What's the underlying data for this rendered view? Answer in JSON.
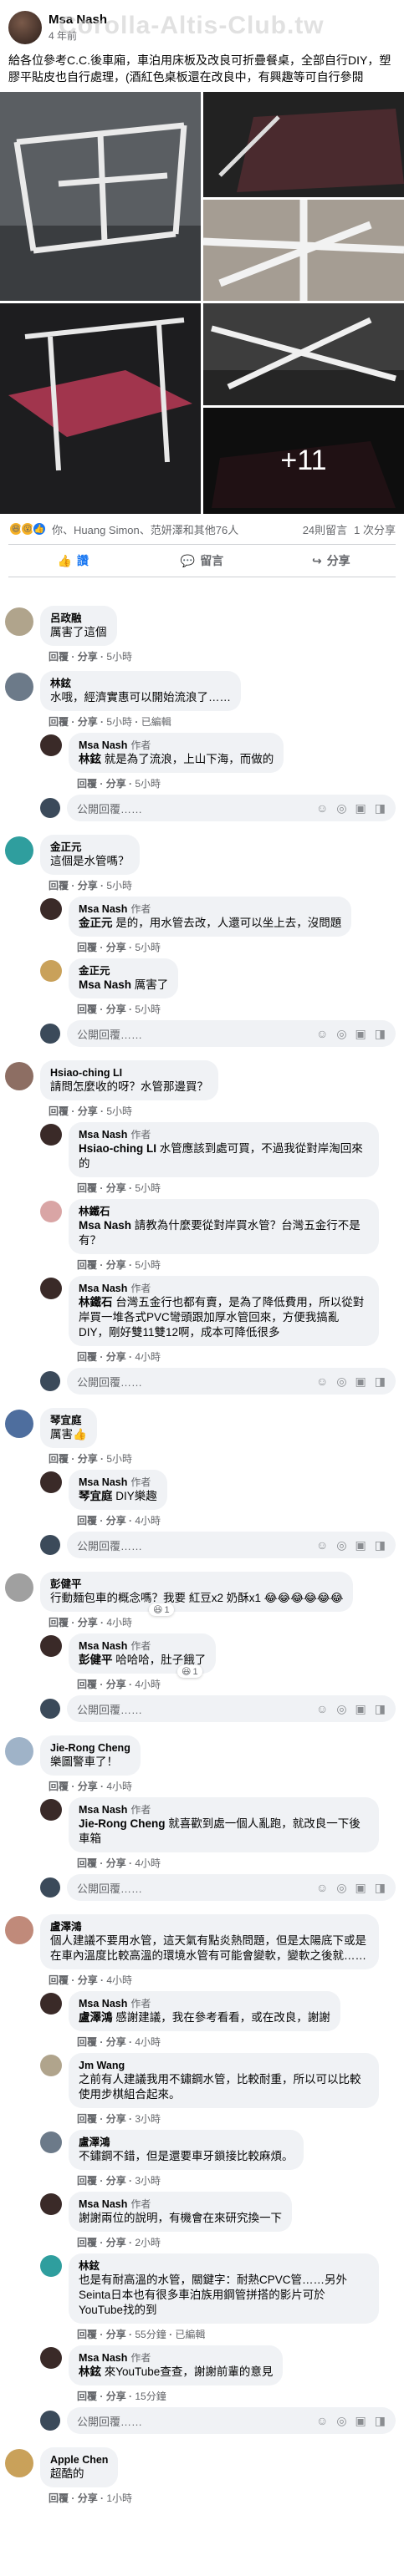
{
  "post": {
    "author": "Msa Nash",
    "time": "4 年前",
    "watermark": "Corolla-Altis-Club.tw",
    "text": "給各位參考C.C.後車廂，車泊用床板及改良可折疊餐桌，全部自行DIY，塑膠平貼皮也自行處理，(酒紅色桌板還在改良中，有興趣等可自行參閱",
    "more_photos": "+11",
    "reactions_text": "你、Huang Simon、范妍澤和其他76人",
    "comment_count": "24則留言",
    "share_count": "1 次分享",
    "actions": {
      "like": "讚",
      "comment": "留言",
      "share": "分享"
    }
  },
  "comments": [
    {
      "name": "呂政融",
      "text": "厲害了這個",
      "reply": "回覆",
      "share": "分享",
      "time": "5小時"
    },
    {
      "name": "林鉉",
      "text": "水哦，經濟實惠可以開始流浪了……",
      "reply": "回覆",
      "share": "分享",
      "time": "5小時",
      "edited": "已編輯",
      "replies": [
        {
          "name": "Msa Nash",
          "badge": "作者",
          "tag": "林鉉",
          "text": "就是為了流浪，上山下海，而做的",
          "reply": "回覆",
          "share": "分享",
          "time": "5小時"
        }
      ]
    },
    {
      "name": "金正元",
      "text": "這個是水管嗎？",
      "reply": "回覆",
      "share": "分享",
      "time": "5小時",
      "replies": [
        {
          "name": "Msa Nash",
          "badge": "作者",
          "tag": "金正元",
          "text": "是的，用水管去改，人還可以坐上去，沒問題",
          "reply": "回覆",
          "share": "分享",
          "time": "5小時"
        },
        {
          "name": "金正元",
          "tag": "Msa Nash",
          "text": "厲害了",
          "reply": "回覆",
          "share": "分享",
          "time": "5小時"
        }
      ]
    },
    {
      "name": "Hsiao-ching LI",
      "text": "請問怎麼收的呀？水管那邊買？",
      "reply": "回覆",
      "share": "分享",
      "time": "5小時",
      "replies": [
        {
          "name": "Msa Nash",
          "badge": "作者",
          "tag": "Hsiao-ching LI",
          "text": "水管應該到處可買，不過我從對岸淘回來的",
          "reply": "回覆",
          "share": "分享",
          "time": "5小時"
        },
        {
          "name": "林鐵石",
          "tag": "Msa Nash",
          "text": "請教為什麼要從對岸買水管？台灣五金行不是有？",
          "reply": "回覆",
          "share": "分享",
          "time": "5小時"
        },
        {
          "name": "Msa Nash",
          "badge": "作者",
          "tag": "林鐵石",
          "text": "台灣五金行也都有賣，是為了降低費用，所以從對岸買一堆各式PVC彎頭跟加厚水管回來，方便我搞亂DIY，剛好雙11雙12啊，成本可降低很多",
          "reply": "回覆",
          "share": "分享",
          "time": "4小時"
        }
      ]
    },
    {
      "name": "琴宜庭",
      "text": "厲害👍",
      "reply": "回覆",
      "share": "分享",
      "time": "5小時",
      "replies": [
        {
          "name": "Msa Nash",
          "badge": "作者",
          "tag": "琴宜庭",
          "text": "DIY樂趣",
          "reply": "回覆",
          "share": "分享",
          "time": "4小時"
        }
      ]
    },
    {
      "name": "彭健平",
      "text": "行動麵包車的概念嗎？我要 紅豆x2 奶酥x1 😂😂😂😂😂😂",
      "reply": "回覆",
      "share": "分享",
      "time": "4小時",
      "chip": "1",
      "replies": [
        {
          "name": "Msa Nash",
          "badge": "作者",
          "tag": "彭健平",
          "text": "哈哈哈，肚子餓了",
          "reply": "回覆",
          "share": "分享",
          "time": "4小時",
          "chip": "1"
        }
      ]
    },
    {
      "name": "Jie-Rong Cheng",
      "text": "樂圖警車了！",
      "reply": "回覆",
      "share": "分享",
      "time": "4小時",
      "replies": [
        {
          "name": "Msa Nash",
          "badge": "作者",
          "tag": "Jie-Rong Cheng",
          "text": "就喜歡到處一個人亂跑，就改良一下後車箱",
          "reply": "回覆",
          "share": "分享",
          "time": "4小時"
        }
      ]
    },
    {
      "name": "盧澤鴻",
      "text": "個人建議不要用水管，這天氣有點炎熱問題，但是太陽底下或是在車內溫度比較高溫的環境水管有可能會變軟，變軟之後就……",
      "reply": "回覆",
      "share": "分享",
      "time": "4小時",
      "replies": [
        {
          "name": "Msa Nash",
          "badge": "作者",
          "tag": "盧澤鴻",
          "text": "感謝建議，我在參考看看，或在改良，謝謝",
          "reply": "回覆",
          "share": "分享",
          "time": "4小時"
        },
        {
          "name": "Jm Wang",
          "text": "之前有人建議我用不鏽鋼水管，比較耐重，所以可以比較使用步棋組合起來。",
          "reply": "回覆",
          "share": "分享",
          "time": "3小時"
        },
        {
          "name": "盧澤鴻",
          "text": "不鏽鋼不錯，但是還要車牙鎖接比較麻煩。",
          "reply": "回覆",
          "share": "分享",
          "time": "3小時"
        },
        {
          "name": "Msa Nash",
          "badge": "作者",
          "text": "謝謝兩位的說明，有機會在來研究換一下",
          "reply": "回覆",
          "share": "分享",
          "time": "2小時"
        },
        {
          "name": "林鉉",
          "text": "也是有耐高溫的水管，關鍵字：耐熱CPVC管……另外Seinta日本也有很多車泊族用鋼管拼搭的影片可於YouTube找的到",
          "reply": "回覆",
          "share": "分享",
          "time": "55分鐘",
          "edited": "已編輯"
        },
        {
          "name": "Msa Nash",
          "badge": "作者",
          "tag": "林鉉",
          "text": "來YouTube查查，謝謝前輩的意見",
          "reply": "回覆",
          "share": "分享",
          "time": "15分鐘"
        }
      ]
    },
    {
      "name": "Apple Chen",
      "text": "超酷的",
      "reply": "回覆",
      "share": "分享",
      "time": "1小時"
    }
  ],
  "reply_placeholder": "公開回覆……",
  "colors": {
    "like_blue": "#1877f2",
    "bubble": "#f0f2f5",
    "meta": "#65676b"
  }
}
